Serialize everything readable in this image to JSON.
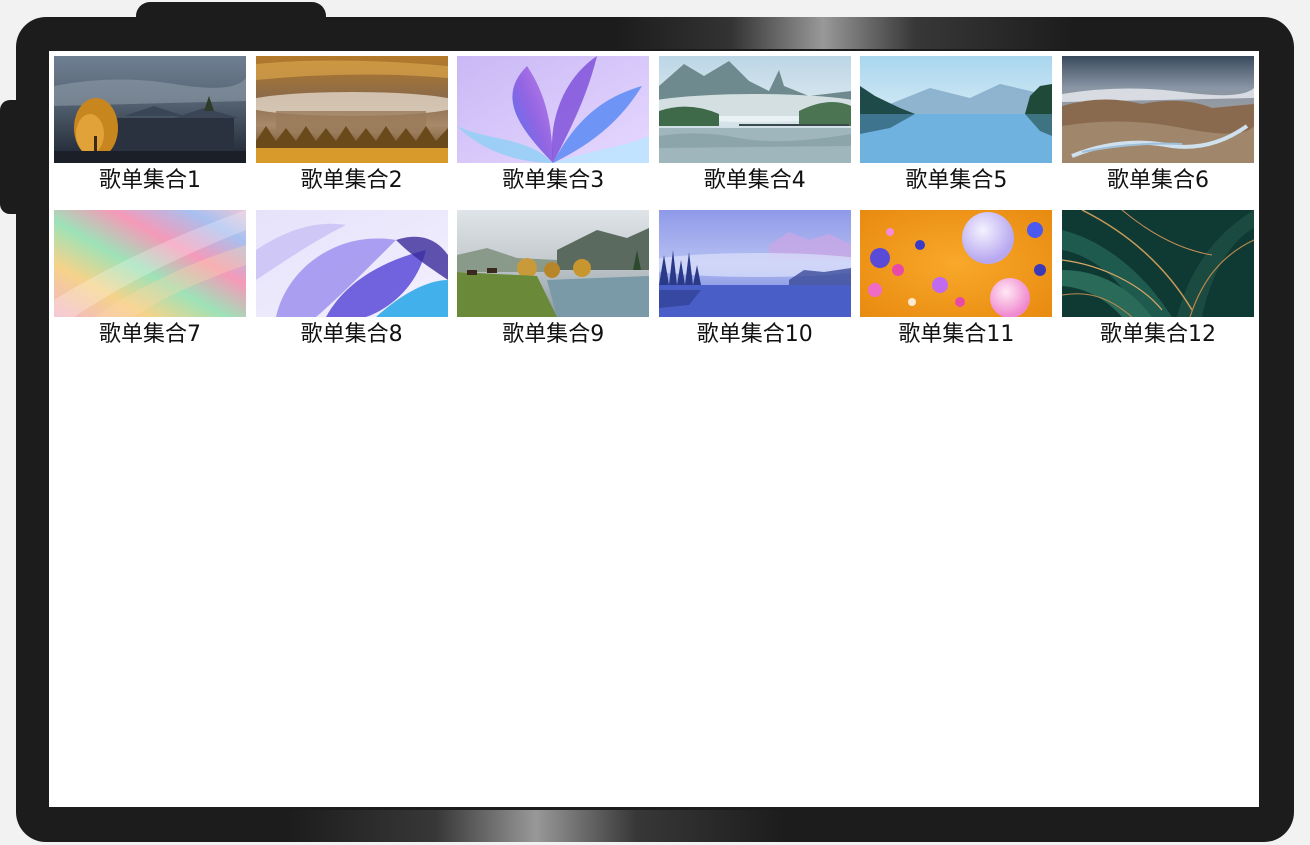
{
  "playlists": [
    {
      "title": "歌单集合1",
      "image": "autumn-village-landscape"
    },
    {
      "title": "歌单集合2",
      "image": "misty-village-sunrise"
    },
    {
      "title": "歌单集合3",
      "image": "abstract-purple-petals"
    },
    {
      "title": "歌单集合4",
      "image": "misty-lake-mountains"
    },
    {
      "title": "歌单集合5",
      "image": "blue-lake-reflection"
    },
    {
      "title": "歌单集合6",
      "image": "river-valley-plateau"
    },
    {
      "title": "歌单集合7",
      "image": "abstract-rainbow-gradient"
    },
    {
      "title": "歌单集合8",
      "image": "abstract-blue-petals"
    },
    {
      "title": "歌单集合9",
      "image": "river-meadow-horses"
    },
    {
      "title": "歌单集合10",
      "image": "foggy-blue-forest-lake"
    },
    {
      "title": "歌单集合11",
      "image": "orange-bubbles-abstract"
    },
    {
      "title": "歌单集合12",
      "image": "tropical-green-leaves"
    }
  ]
}
